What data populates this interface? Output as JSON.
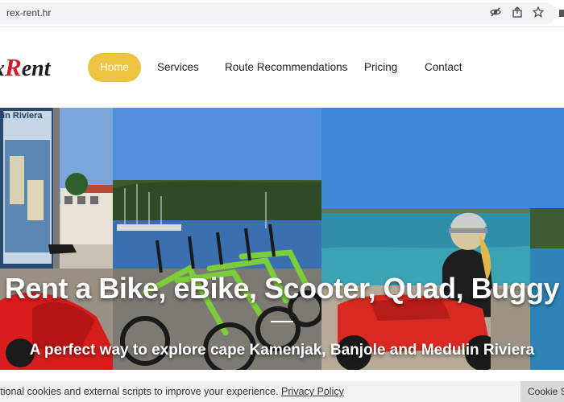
{
  "browser": {
    "url": "rex-rent.hr"
  },
  "site": {
    "logo_prefix": "x",
    "logo_r": "R",
    "logo_suffix": "ent"
  },
  "nav": {
    "home": "Home",
    "services": "Services",
    "routes": "Route Recommendations",
    "pricing": "Pricing",
    "contact": "Contact"
  },
  "hero": {
    "map_label": "lin Riviera",
    "title": "Rent a Bike, eBike, Scooter, Quad, Buggy",
    "subtitle": "A perfect way to explore cape Kamenjak, Banjole and Medulin Riviera"
  },
  "cookie": {
    "text": "ctional cookies and external scripts to improve your experience.",
    "link": "Privacy Policy",
    "button": "Cookie Set"
  },
  "colors": {
    "accent": "#ecc441",
    "logo_red": "#c8202a"
  }
}
